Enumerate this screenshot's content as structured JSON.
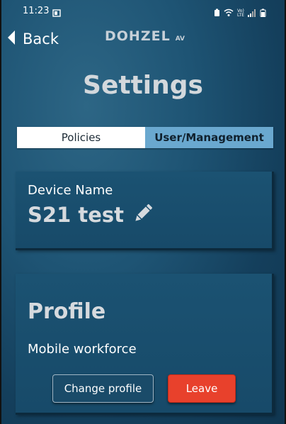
{
  "status_bar": {
    "time": "11:23",
    "network_top": "Vo)",
    "network_bottom": "LTE"
  },
  "header": {
    "back_label": "Back",
    "brand_name": "DOHZEL",
    "brand_suffix": "AV"
  },
  "page": {
    "title": "Settings"
  },
  "tabs": [
    {
      "label": "Policies",
      "active": false
    },
    {
      "label": "User/Management",
      "active": true
    }
  ],
  "device_card": {
    "label": "Device Name",
    "value": "S21 test"
  },
  "profile_card": {
    "title": "Profile",
    "value": "Mobile workforce",
    "change_button_label": "Change profile",
    "leave_button_label": "Leave"
  },
  "colors": {
    "background": "#1e5474",
    "active_tab": "#6aa8cf",
    "leave_button": "#e8412c"
  },
  "icons": [
    "back-chevron-icon",
    "edit-pencil-icon",
    "wifi-icon",
    "signal-icon",
    "battery-icon"
  ]
}
